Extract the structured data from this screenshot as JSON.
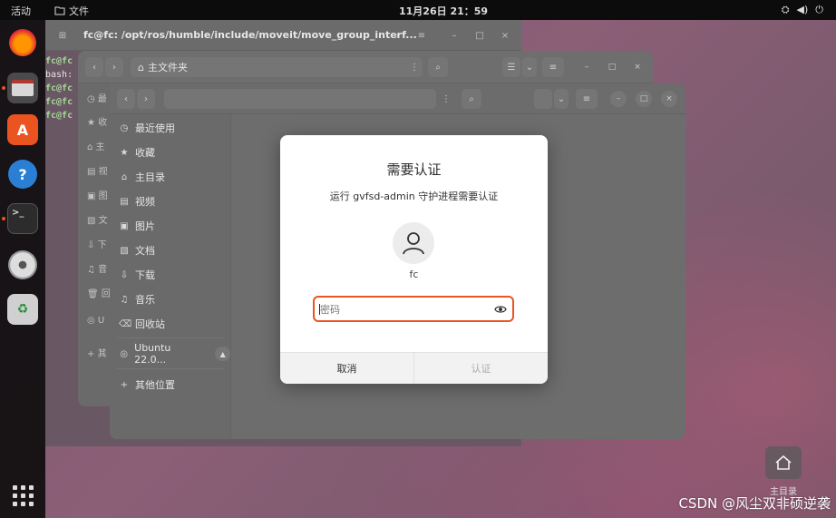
{
  "topbar": {
    "activities": "活动",
    "app_name": "文件",
    "clock": "11月26日 21：59"
  },
  "terminal": {
    "title": "fc@fc: /opt/ros/humble/include/moveit/move_group_interf...",
    "lines": [
      "fc@fc",
      "bash:",
      "fc@fc",
      "fc@fc",
      "fc@fc"
    ]
  },
  "file_manager_back": {
    "path": "主文件夹",
    "sidebar_letters": [
      "最",
      "收",
      "主",
      "视",
      "图",
      "文",
      "下",
      "音",
      "回",
      "U",
      "其"
    ]
  },
  "file_manager_front": {
    "sidebar": {
      "recent": "最近使用",
      "starred": "收藏",
      "home": "主目录",
      "videos": "视频",
      "pictures": "图片",
      "documents": "文档",
      "downloads": "下载",
      "music": "音乐",
      "trash": "回收站",
      "volume": "Ubuntu 22.0...",
      "other": "其他位置"
    }
  },
  "auth_dialog": {
    "title": "需要认证",
    "subtitle": "运行 gvfsd-admin 守护进程需要认证",
    "username": "fc",
    "password_placeholder": "密码",
    "cancel": "取消",
    "authenticate": "认证"
  },
  "desktop": {
    "home_label": "主目录"
  },
  "watermark": "CSDN @风尘双非硕逆袭",
  "colors": {
    "accent": "#e95420",
    "topbar": "#0c0c0c",
    "dialog_bg": "#ffffff"
  }
}
